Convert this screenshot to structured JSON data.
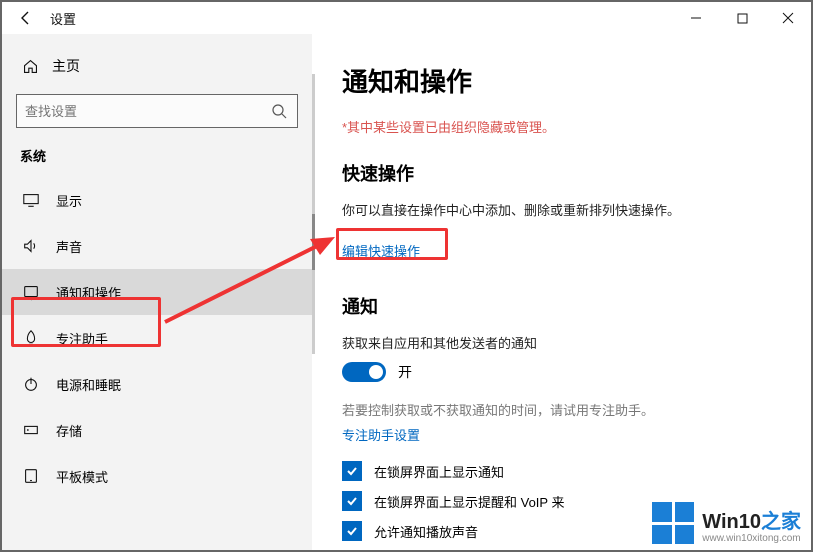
{
  "titlebar": {
    "title": "设置"
  },
  "sidebar": {
    "home_label": "主页",
    "search_placeholder": "查找设置",
    "group_label": "系统",
    "items": [
      {
        "label": "显示"
      },
      {
        "label": "声音"
      },
      {
        "label": "通知和操作"
      },
      {
        "label": "专注助手"
      },
      {
        "label": "电源和睡眠"
      },
      {
        "label": "存储"
      },
      {
        "label": "平板模式"
      }
    ]
  },
  "content": {
    "heading": "通知和操作",
    "warning": "*其中某些设置已由组织隐藏或管理。",
    "section_quick": "快速操作",
    "quick_desc": "你可以直接在操作中心中添加、删除或重新排列快速操作。",
    "edit_quick_link": "编辑快速操作",
    "section_notify": "通知",
    "notify_desc": "获取来自应用和其他发送者的通知",
    "toggle_on": "开",
    "focus_hint": "若要控制获取或不获取通知的时间，请试用专注助手。",
    "focus_link": "专注助手设置",
    "check1": "在锁屏界面上显示通知",
    "check2": "在锁屏界面上显示提醒和 VoIP 来",
    "check3": "允许通知播放声音"
  },
  "watermark": {
    "brand_a": "Win10",
    "brand_b": "之家",
    "url": "www.win10xitong.com"
  }
}
